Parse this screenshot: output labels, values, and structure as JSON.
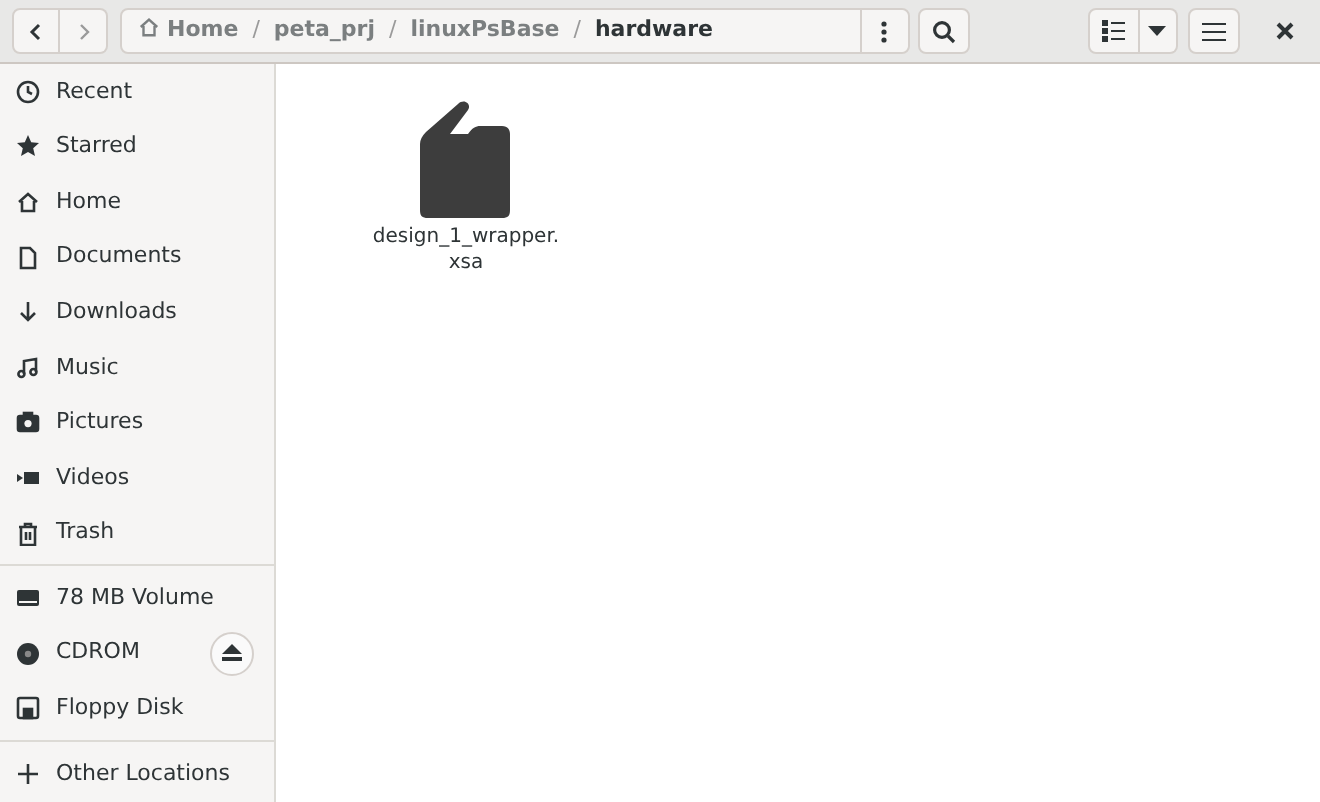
{
  "path_bar": {
    "segments": [
      {
        "label": "Home",
        "kind": "home",
        "current": false
      },
      {
        "label": "peta_prj",
        "kind": "folder",
        "current": false
      },
      {
        "label": "linuxPsBase",
        "kind": "folder",
        "current": false
      },
      {
        "label": "hardware",
        "kind": "folder",
        "current": true
      }
    ],
    "separator": "/"
  },
  "sidebar": {
    "groups": [
      {
        "items": [
          {
            "label": "Recent",
            "kind": "recent"
          },
          {
            "label": "Starred",
            "kind": "starred"
          },
          {
            "label": "Home",
            "kind": "home"
          },
          {
            "label": "Documents",
            "kind": "documents"
          },
          {
            "label": "Downloads",
            "kind": "downloads"
          },
          {
            "label": "Music",
            "kind": "music"
          },
          {
            "label": "Pictures",
            "kind": "pictures"
          },
          {
            "label": "Videos",
            "kind": "videos"
          },
          {
            "label": "Trash",
            "kind": "trash"
          }
        ]
      },
      {
        "items": [
          {
            "label": "78 MB Volume",
            "kind": "drive",
            "ejectable": false
          },
          {
            "label": "CDROM",
            "kind": "disc",
            "ejectable": true
          },
          {
            "label": "Floppy Disk",
            "kind": "floppy",
            "ejectable": false
          }
        ]
      },
      {
        "items": [
          {
            "label": "Other Locations",
            "kind": "other"
          }
        ]
      }
    ]
  },
  "files": [
    {
      "name": "design_1_wrapper.\nxsa",
      "kind": "file"
    }
  ]
}
